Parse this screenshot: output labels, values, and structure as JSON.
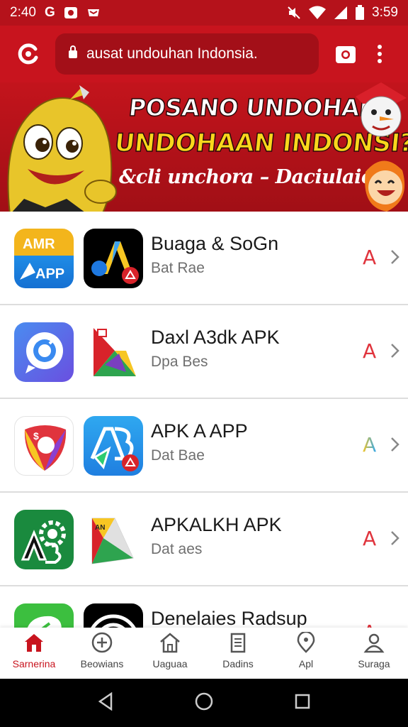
{
  "status_bar": {
    "time_left": "2:40",
    "carrier_glyph": "G",
    "time_right": "3:59",
    "icons": [
      "photo-icon",
      "mail-icon",
      "mute-icon",
      "wifi-icon",
      "signal-icon",
      "battery-icon"
    ]
  },
  "toolbar": {
    "url": "ausat undouhan Indonsia.",
    "icons": [
      "logo-icon",
      "lock-icon",
      "camera-icon",
      "more-icon"
    ]
  },
  "banner": {
    "line1": "POSANO UNDOHAN",
    "line2": "UNDOHAAN INDONSI?",
    "line3": "&cli unchora – Daciulaiona"
  },
  "apps": [
    {
      "title": "Buaga & SoGn",
      "subtitle": "Bat Rae",
      "badge": "A",
      "badge_color": "#e0343d",
      "icon1_text": "AMR",
      "icon1_sub": "APP"
    },
    {
      "title": "Daxl A3dk APK",
      "subtitle": "Dpa Bes",
      "badge": "A",
      "badge_color": "#e0343d"
    },
    {
      "title": "APK A APP",
      "subtitle": "Dat Bae",
      "badge": "A",
      "badge_color": "multicolor"
    },
    {
      "title": "APKALKH APK",
      "subtitle": "Dat aes",
      "badge": "A",
      "badge_color": "#e0343d"
    },
    {
      "title": "Denelaies Radsup",
      "subtitle": "",
      "badge": "A",
      "badge_color": "#e0343d"
    }
  ],
  "bottom_nav": [
    {
      "label": "Sarnerina",
      "icon": "home-icon",
      "active": true
    },
    {
      "label": "Beowians",
      "icon": "plus-circle-icon",
      "active": false
    },
    {
      "label": "Uaguaa",
      "icon": "house-outline-icon",
      "active": false
    },
    {
      "label": "Dadins",
      "icon": "document-icon",
      "active": false
    },
    {
      "label": "Apl",
      "icon": "location-icon",
      "active": false
    },
    {
      "label": "Suraga",
      "icon": "profile-icon",
      "active": false
    }
  ],
  "colors": {
    "accent": "#c8141e",
    "badge_red": "#e0343d"
  }
}
